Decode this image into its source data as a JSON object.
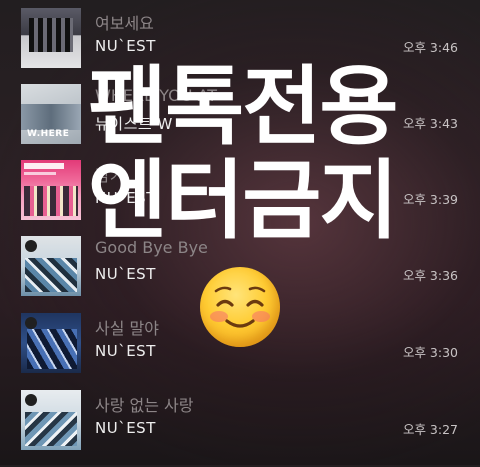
{
  "songs": [
    {
      "title": "여보세요",
      "artist": "NU`EST",
      "time": "오후 3:46"
    },
    {
      "title": "WHERE YOU AT",
      "artist": "뉴이스트 W",
      "time": "오후 3:43"
    },
    {
      "title": "감기",
      "artist": "NU`EST",
      "time": "오후 3:39"
    },
    {
      "title": "Good Bye Bye",
      "artist": "NU`EST",
      "time": "오후 3:36"
    },
    {
      "title": "사실 말야",
      "artist": "NU`EST",
      "time": "오후 3:30"
    },
    {
      "title": "사랑 없는 사랑",
      "artist": "NU`EST",
      "time": "오후 3:27"
    }
  ],
  "album_covers": [
    {
      "text": ""
    },
    {
      "text": "W.HERE"
    },
    {
      "text": ""
    },
    {
      "text": ""
    },
    {
      "text": ""
    },
    {
      "text": ""
    }
  ],
  "overlay": {
    "line1": "팬톡전용",
    "line2": "엔터금지",
    "emoji": "smiling-face-with-smiling-eyes"
  },
  "colors": {
    "title_text": "#8c8587",
    "artist_text": "#eeeeee",
    "time_text": "#c8c3c4",
    "overlay_text": "#ffffff"
  }
}
